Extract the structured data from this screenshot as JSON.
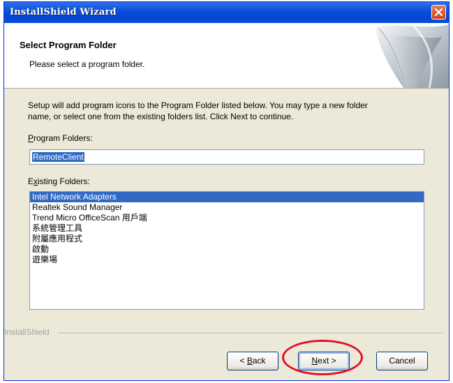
{
  "window": {
    "title": "InstallShield Wizard",
    "close_icon": "close-icon"
  },
  "header": {
    "title": "Select Program Folder",
    "subtitle": "Please select a program folder."
  },
  "body": {
    "description_line1": "Setup will add program icons to the Program Folder listed below.  You may type a new folder",
    "description_line2": "name, or select one from the existing folders list.  Click Next to continue.",
    "program_folders_label_mnemonic": "P",
    "program_folders_label_rest": "rogram Folders:",
    "program_folder_value": "RemoteClient",
    "existing_folders_label_first": "E",
    "existing_folders_label_mnemonic": "x",
    "existing_folders_label_rest": "isting Folders:",
    "existing_folders": [
      "Intel Network Adapters",
      "Realtek Sound Manager",
      "Trend Micro OfficeScan 用戶端",
      "系統管理工具",
      "附屬應用程式",
      "啟動",
      "遊樂場"
    ],
    "selected_folder_index": 0
  },
  "footer": {
    "brand": "InstallShield",
    "back_prefix": "< ",
    "back_mnemonic": "B",
    "back_rest": "ack",
    "next_mnemonic": "N",
    "next_rest": "ext >",
    "cancel_label": "Cancel"
  },
  "colors": {
    "titlebar": "#0A4EDB",
    "selection": "#316AC5",
    "annotation": "#E0102A"
  }
}
